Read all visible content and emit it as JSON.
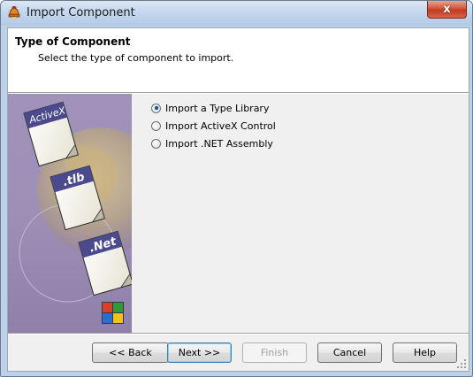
{
  "window": {
    "title": "Import Component",
    "close_glyph": "x",
    "app_icon": "helmet-icon"
  },
  "header": {
    "title": "Type of Component",
    "subtitle": "Select the type of component to import."
  },
  "art": {
    "cards": [
      "ActiveX",
      ".tlb",
      ".Net"
    ]
  },
  "options": [
    {
      "label": "Import a Type Library",
      "selected": true
    },
    {
      "label": "Import ActiveX Control",
      "selected": false
    },
    {
      "label": "Import .NET Assembly",
      "selected": false
    }
  ],
  "buttons": {
    "back": "<< Back",
    "next": "Next >>",
    "finish": "Finish",
    "cancel": "Cancel",
    "help": "Help"
  },
  "colors": {
    "accent": "#1e4f9c",
    "art_bg": "#9a8cb5",
    "card_band": "#4b4a8c"
  }
}
